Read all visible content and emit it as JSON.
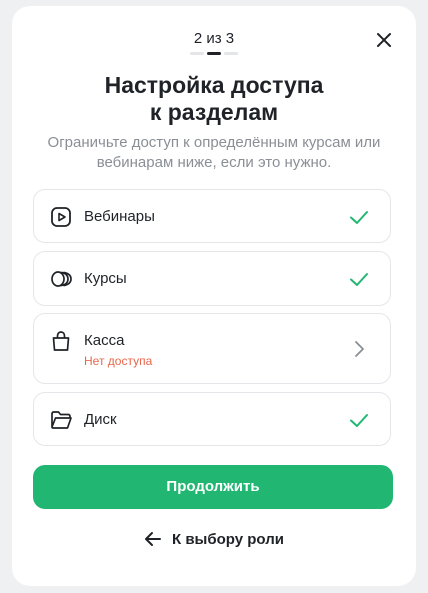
{
  "stepper": {
    "text": "2 из 3",
    "current": 2,
    "total": 3
  },
  "title": {
    "line1": "Настройка доступа",
    "line2": "к разделам"
  },
  "subtitle": {
    "line1": "Ограничьте доступ к определённым курсам или",
    "line2": "вебинарам ниже, если это нужно."
  },
  "items": [
    {
      "label": "Вебинары",
      "icon": "play-square-icon",
      "status_icon": "check-icon"
    },
    {
      "label": "Курсы",
      "icon": "stacked-cards-icon",
      "status_icon": "check-icon"
    },
    {
      "label": "Касса",
      "sublabel": "Нет доступа",
      "icon": "shopping-bag-icon",
      "status_icon": "chevron-right-icon"
    },
    {
      "label": "Диск",
      "icon": "folder-icon",
      "status_icon": "check-icon"
    }
  ],
  "continue_label": "Продолжить",
  "back_label": "К выбору роли",
  "colors": {
    "accent": "#21b672",
    "check": "#21b672",
    "no_access": "#e8664a"
  }
}
